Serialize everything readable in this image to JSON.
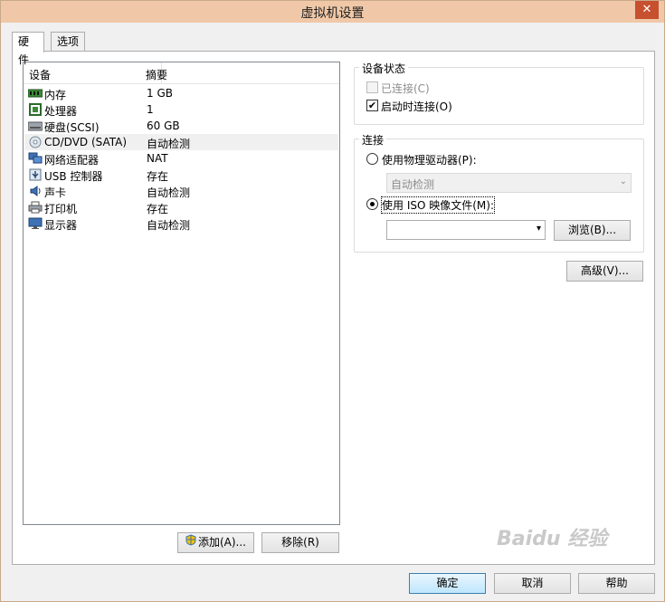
{
  "window": {
    "title": "虚拟机设置",
    "close_label": "✕"
  },
  "tabs": [
    {
      "label": "硬件"
    },
    {
      "label": "选项"
    }
  ],
  "device_list": {
    "headers": {
      "device": "设备",
      "summary": "摘要"
    },
    "items": [
      {
        "name": "内存",
        "summary": "1 GB",
        "icon": "memory-icon"
      },
      {
        "name": "处理器",
        "summary": "1",
        "icon": "processor-icon"
      },
      {
        "name": "硬盘(SCSI)",
        "summary": "60 GB",
        "icon": "hard-disk-icon"
      },
      {
        "name": "CD/DVD (SATA)",
        "summary": "自动检测",
        "icon": "cd-dvd-icon",
        "selected": true
      },
      {
        "name": "网络适配器",
        "summary": "NAT",
        "icon": "network-adapter-icon"
      },
      {
        "name": "USB 控制器",
        "summary": "存在",
        "icon": "usb-icon"
      },
      {
        "name": "声卡",
        "summary": "自动检测",
        "icon": "sound-card-icon"
      },
      {
        "name": "打印机",
        "summary": "存在",
        "icon": "printer-icon"
      },
      {
        "name": "显示器",
        "summary": "自动检测",
        "icon": "display-icon"
      }
    ],
    "add_button": "添加(A)...",
    "remove_button": "移除(R)"
  },
  "device_status": {
    "title": "设备状态",
    "connected": {
      "label": "已连接(C)",
      "checked": false,
      "disabled": true
    },
    "connect_at_power_on": {
      "label": "启动时连接(O)",
      "checked": true
    }
  },
  "connection": {
    "title": "连接",
    "physical_drive": {
      "label": "使用物理驱动器(P):",
      "selected": false
    },
    "physical_drive_select": {
      "value": "自动检测"
    },
    "iso_image": {
      "label": "使用 ISO 映像文件(M):",
      "selected": true
    },
    "iso_path": {
      "value": ""
    },
    "browse_button": "浏览(B)..."
  },
  "advanced_button": "高级(V)...",
  "footer": {
    "ok": "确定",
    "cancel": "取消",
    "help": "帮助"
  },
  "watermark": "Baidu 经验",
  "colors": {
    "title_bar": "#f0c8a8",
    "close_button": "#c7502e",
    "selection": "#f0f0f0"
  }
}
